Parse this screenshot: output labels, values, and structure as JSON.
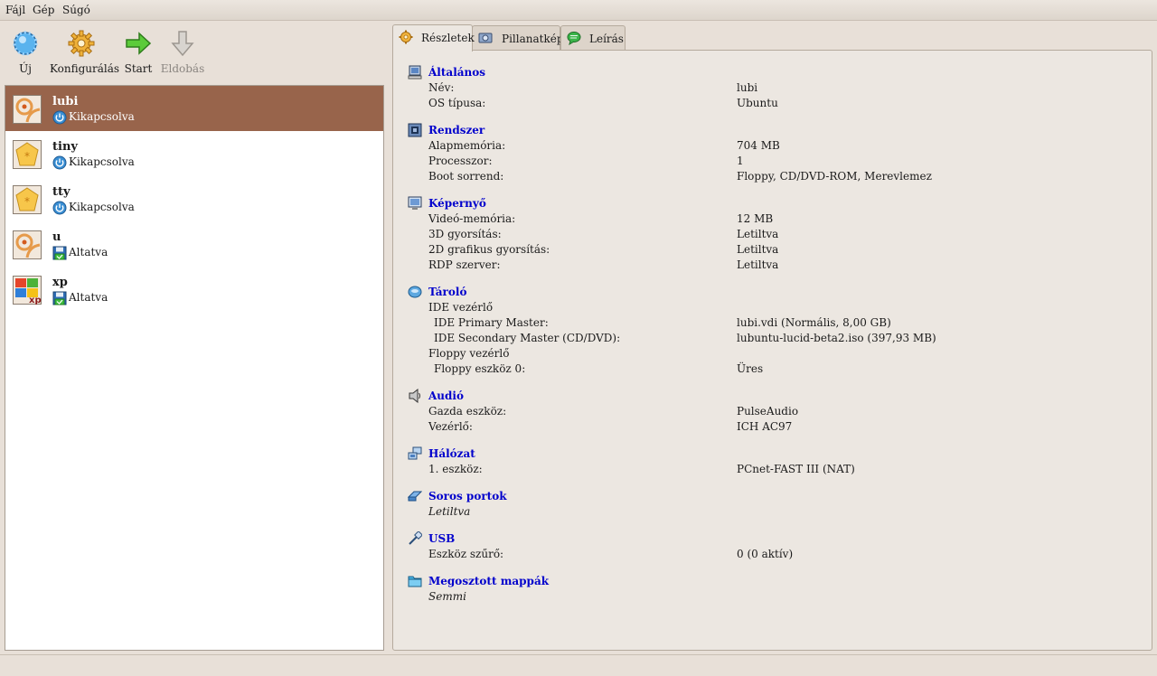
{
  "menu": {
    "file": "Fájl",
    "machine": "Gép",
    "help": "Súgó"
  },
  "toolbar": {
    "new": "Új",
    "configure": "Konfigurálás",
    "start": "Start",
    "discard": "Eldobás"
  },
  "vms": [
    {
      "name": "lubi",
      "state": "Kikapcsolva",
      "state_icon": "power-off-icon",
      "os_icon": "ubuntu-icon",
      "selected": true
    },
    {
      "name": "tiny",
      "state": "Kikapcsolva",
      "state_icon": "power-off-icon",
      "os_icon": "other-os-icon"
    },
    {
      "name": "tty",
      "state": "Kikapcsolva",
      "state_icon": "power-off-icon",
      "os_icon": "other-os-icon"
    },
    {
      "name": "u",
      "state": "Altatva",
      "state_icon": "saved-state-icon",
      "os_icon": "ubuntu-icon"
    },
    {
      "name": "xp",
      "state": "Altatva",
      "state_icon": "saved-state-icon",
      "os_icon": "windows-xp-icon"
    }
  ],
  "tabs": {
    "details": "Részletek",
    "snapshots": "Pillanatkép",
    "description": "Leírás"
  },
  "details": {
    "general": {
      "title": "Általános",
      "name_label": "Név:",
      "name_value": "lubi",
      "os_label": "OS típusa:",
      "os_value": "Ubuntu"
    },
    "system": {
      "title": "Rendszer",
      "mem_label": "Alapmemória:",
      "mem_value": "704 MB",
      "cpu_label": "Processzor:",
      "cpu_value": "1",
      "boot_label": "Boot sorrend:",
      "boot_value": "Floppy, CD/DVD-ROM, Merevlemez"
    },
    "display": {
      "title": "Képernyő",
      "vmem_label": "Videó-memória:",
      "vmem_value": "12 MB",
      "accel3d_label": "3D gyorsítás:",
      "accel3d_value": "Letiltva",
      "accel2d_label": "2D grafikus gyorsítás:",
      "accel2d_value": "Letiltva",
      "rdp_label": "RDP szerver:",
      "rdp_value": "Letiltva"
    },
    "storage": {
      "title": "Tároló",
      "ide_ctrl": "IDE vezérlő",
      "ide_pm_label": "IDE Primary Master:",
      "ide_pm_value": "lubi.vdi (Normális, 8,00 GB)",
      "ide_sm_label": "IDE Secondary Master (CD/DVD):",
      "ide_sm_value": "lubuntu-lucid-beta2.iso (397,93 MB)",
      "floppy_ctrl": "Floppy vezérlő",
      "floppy_label": "Floppy eszköz 0:",
      "floppy_value": "Üres"
    },
    "audio": {
      "title": "Audió",
      "host_label": "Gazda eszköz:",
      "host_value": "PulseAudio",
      "ctrl_label": "Vezérlő:",
      "ctrl_value": "ICH AC97"
    },
    "network": {
      "title": "Hálózat",
      "adapter_label": "1. eszköz:",
      "adapter_value": "PCnet-FAST III (NAT)"
    },
    "serial": {
      "title": "Soros portok",
      "value": "Letiltva"
    },
    "usb": {
      "title": "USB",
      "filter_label": "Eszköz szűrő:",
      "filter_value": "0 (0 aktív)"
    },
    "shared": {
      "title": "Megosztott mappák",
      "value": "Semmi"
    }
  },
  "colors": {
    "selection": "#98644b",
    "section_title": "#0000cc"
  }
}
